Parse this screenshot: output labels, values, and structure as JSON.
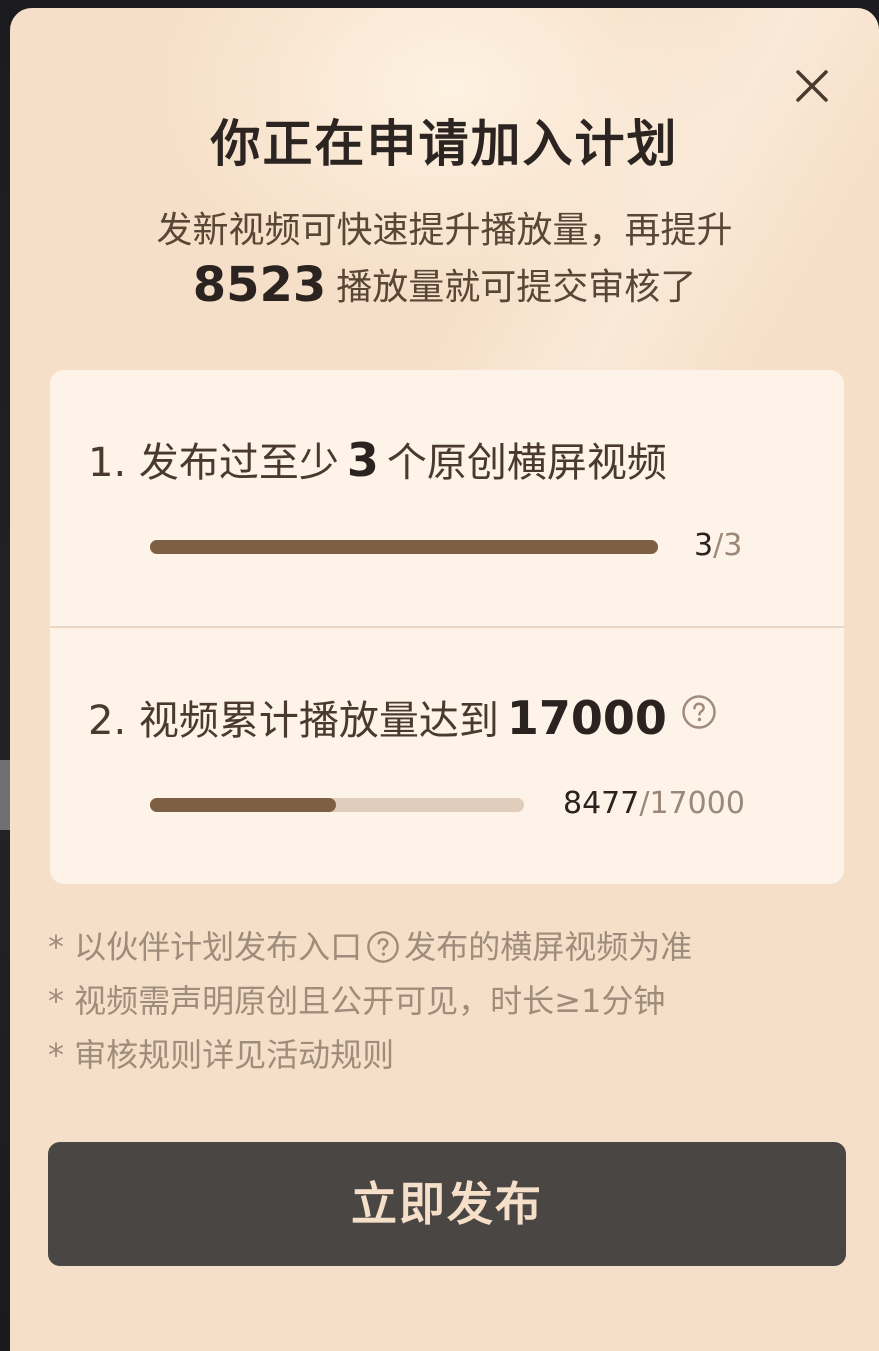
{
  "dialog": {
    "title": "你正在申请加入计划",
    "subtitle_line1": "发新视频可快速提升播放量，再提升",
    "remaining_views": "8523",
    "subtitle_line2": "播放量就可提交审核了",
    "close_icon": "close-icon"
  },
  "requirements": [
    {
      "prefix": "1. 发布过至少",
      "number": "3",
      "suffix": "个原创横屏视频",
      "current": "3",
      "total": "/3",
      "progress": 1.0
    },
    {
      "prefix": "2. 视频累计播放量达到",
      "number": "17000",
      "suffix": "",
      "current": "8477",
      "total": "/17000",
      "progress": 0.4986,
      "help_icon": "question-circle-icon"
    }
  ],
  "notes": {
    "line1_part1": "* 以伙伴计划发布入口",
    "line1_part2": "发布的横屏视频为准",
    "line2": "* 视频需声明原创且公开可见，时长≥1分钟",
    "line3": "* 审核规则详见活动规则"
  },
  "button": {
    "label": "立即发布"
  },
  "colors": {
    "sheet_bg": "#f6dfc8",
    "card_bg": "#fdf3e8",
    "progress_fill": "#7f5f43",
    "progress_track": "#e0cdbb",
    "button_bg": "#4a4644",
    "button_text": "#f6dfc8"
  }
}
